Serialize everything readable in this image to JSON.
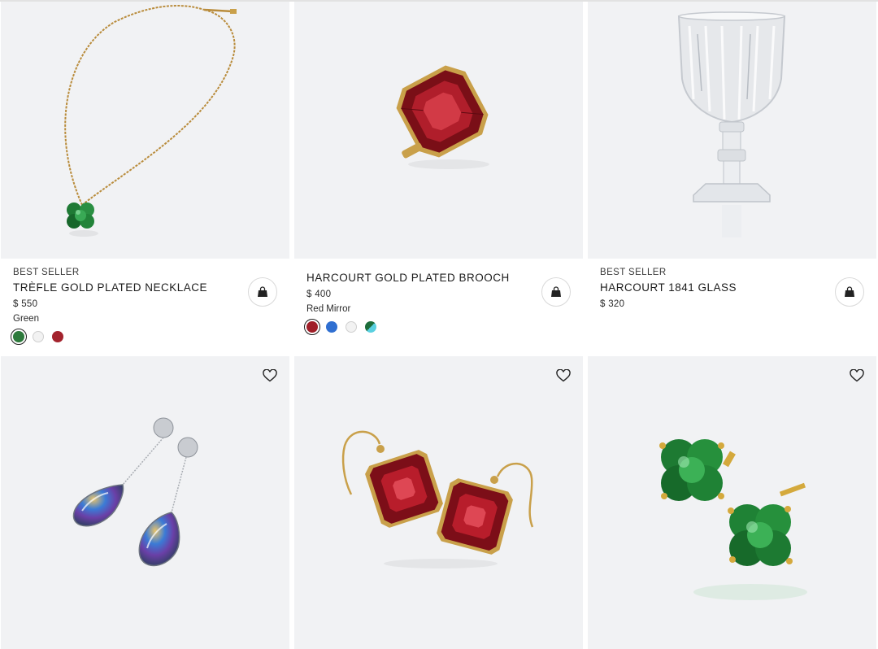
{
  "products": [
    {
      "badge": "BEST SELLER",
      "name": "TRÈFLE GOLD PLATED NECKLACE",
      "price": "$ 550",
      "variant": "Green",
      "swatches": [
        "#2d7a3c",
        "#f2f2f2",
        "#a3232d"
      ],
      "selected_swatch": "Green",
      "image_icon": "necklace-image",
      "action_icon": "shopping-bag-icon"
    },
    {
      "badge": "",
      "name": "HARCOURT GOLD PLATED BROOCH",
      "price": "$ 400",
      "variant": "Red Mirror",
      "swatches": [
        "#9f1e28",
        "#2f6fd1",
        "#f2f2f2",
        "#3ea9b0"
      ],
      "selected_swatch": "Red Mirror",
      "image_icon": "brooch-image",
      "action_icon": "shopping-bag-icon"
    },
    {
      "badge": "BEST SELLER",
      "name": "HARCOURT 1841 GLASS",
      "price": "$ 320",
      "variant": "",
      "swatches": [],
      "image_icon": "crystal-glass-image",
      "action_icon": "shopping-bag-icon"
    },
    {
      "image_icon": "iridescent-drop-earrings-image",
      "action_icon": "heart-icon"
    },
    {
      "image_icon": "red-crystal-earrings-image",
      "action_icon": "heart-icon"
    },
    {
      "image_icon": "green-clover-earrings-image",
      "action_icon": "heart-icon"
    }
  ],
  "colors": {
    "image_background": "#f1f2f4",
    "gold": "#c9a04a",
    "text": "#1c1c1c"
  }
}
